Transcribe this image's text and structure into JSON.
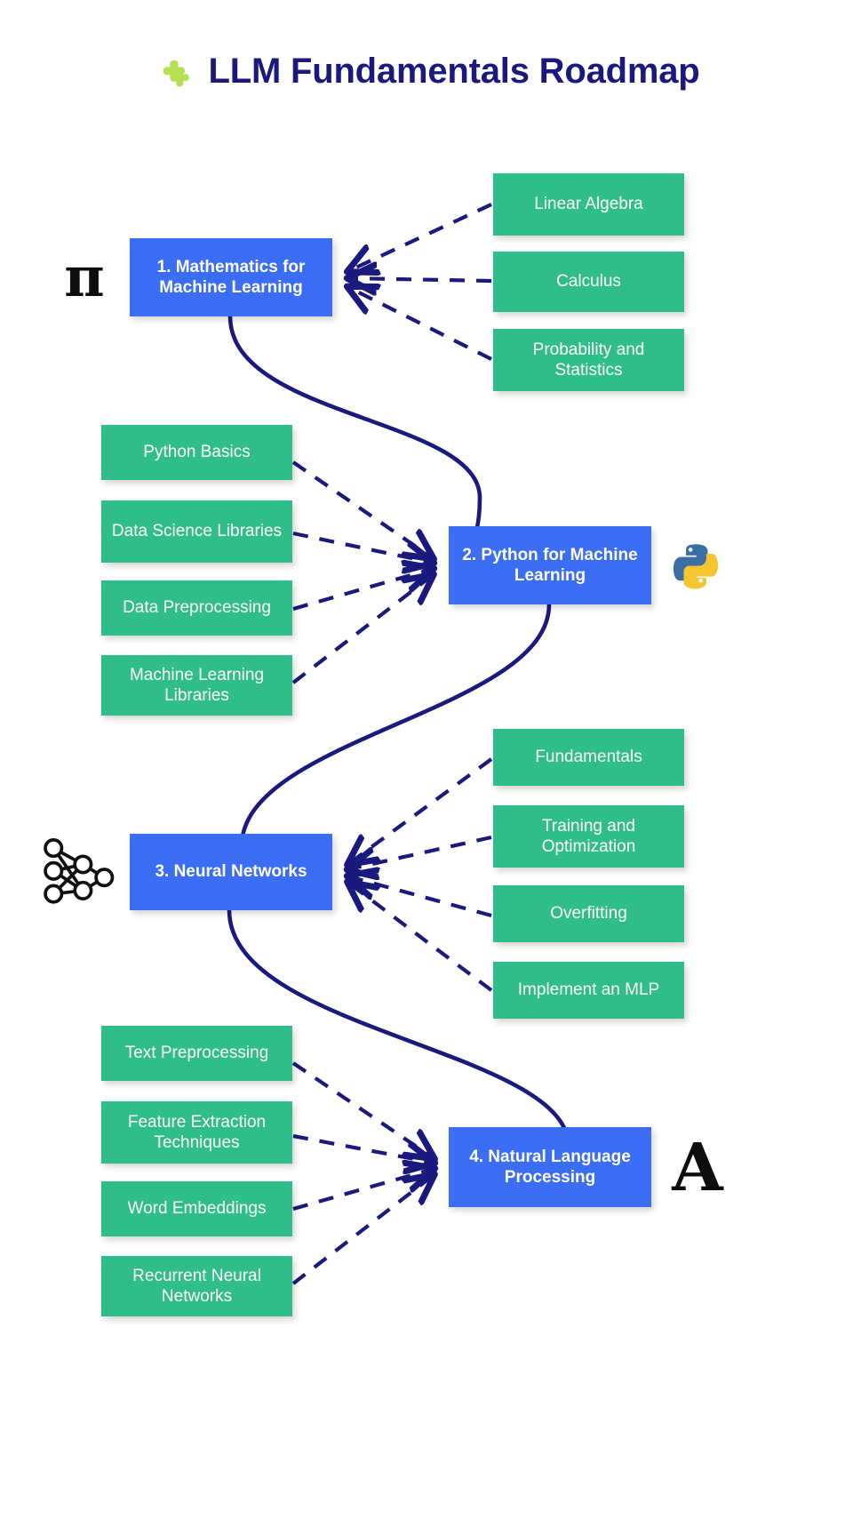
{
  "page": {
    "title": "LLM Fundamentals Roadmap",
    "background_color": "#ffffff"
  },
  "theme": {
    "title_color": "#1a1a7e",
    "main_node_color": "#3b6df5",
    "leaf_node_color": "#2fbd8a",
    "connector_color": "#1a1a7e",
    "node_text_color": "#ffffff",
    "icon_color": "#0d0d0d",
    "puzzle_icon_color": "#b5e052"
  },
  "header": {
    "icon": "puzzle-piece-icon",
    "title": "LLM Fundamentals Roadmap"
  },
  "stages": [
    {
      "id": "mathematics",
      "label": "1.  Mathematics for Machine Learning",
      "number": "1.",
      "name": "Mathematics for Machine Learning",
      "icon": "pi-icon",
      "icon_glyph": "π",
      "topics": [
        "Linear Algebra",
        "Calculus",
        "Probability and Statistics"
      ]
    },
    {
      "id": "python",
      "label": "2.  Python for Machine Learning",
      "number": "2.",
      "name": "Python for Machine Learning",
      "icon": "python-logo-icon",
      "topics": [
        "Python Basics",
        "Data Science Libraries",
        "Data Preprocessing",
        "Machine Learning Libraries"
      ]
    },
    {
      "id": "neural-networks",
      "label": "3.  Neural Networks",
      "number": "3.",
      "name": "Neural Networks",
      "icon": "neural-network-icon",
      "topics": [
        "Fundamentals",
        "Training and Optimization",
        "Overfitting",
        "Implement an MLP"
      ]
    },
    {
      "id": "nlp",
      "label": "4.  Natural Language Processing",
      "number": "4.",
      "name": "Natural Language Processing",
      "icon": "letter-a-icon",
      "icon_glyph": "A",
      "topics": [
        "Text Preprocessing",
        "Feature Extraction Techniques",
        "Word Embeddings",
        "Recurrent Neural Networks"
      ]
    }
  ]
}
